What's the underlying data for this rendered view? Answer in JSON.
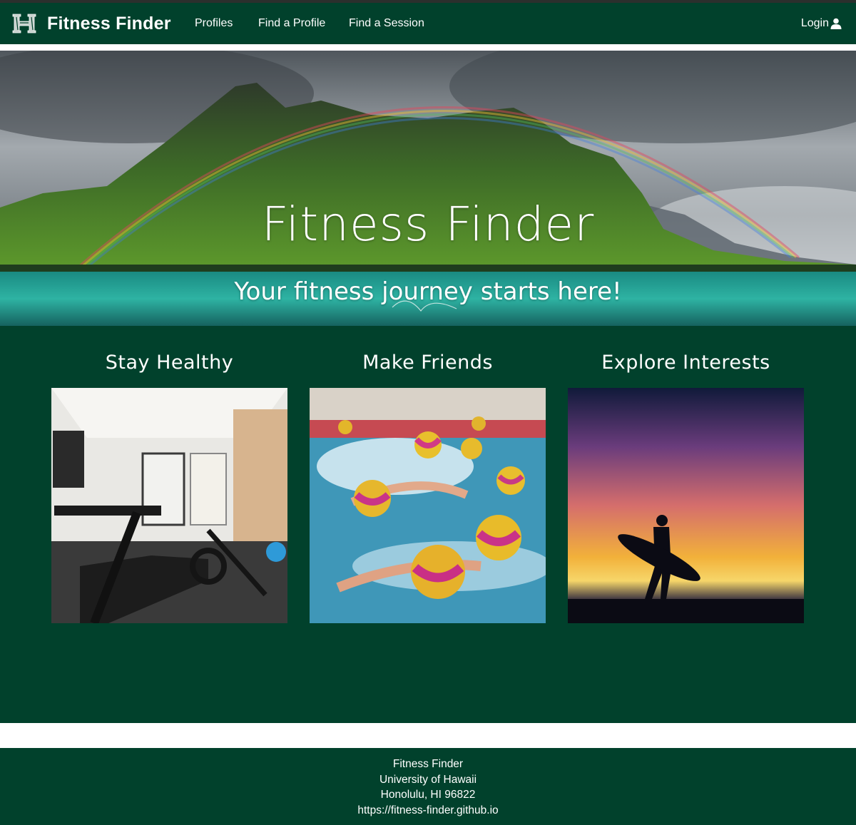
{
  "navbar": {
    "brand_title": "Fitness Finder",
    "links": [
      "Profiles",
      "Find a Profile",
      "Find a Session"
    ],
    "login_label": "Login",
    "colors": {
      "background": "#01412c",
      "text": "#ffffff"
    }
  },
  "hero": {
    "title": "Fitness Finder",
    "subtitle": "Your fitness journey starts here!"
  },
  "features": [
    {
      "heading": "Stay Healthy",
      "image": "home-gym-photo"
    },
    {
      "heading": "Make Friends",
      "image": "water-polo-swimmers-photo"
    },
    {
      "heading": "Explore Interests",
      "image": "surfer-sunset-silhouette-photo"
    }
  ],
  "footer": {
    "lines": [
      "Fitness Finder",
      "University of Hawaii",
      "Honolulu, HI 96822",
      "https://fitness-finder.github.io"
    ]
  },
  "colors": {
    "brand_green": "#01412c",
    "page_background": "#ffffff"
  }
}
